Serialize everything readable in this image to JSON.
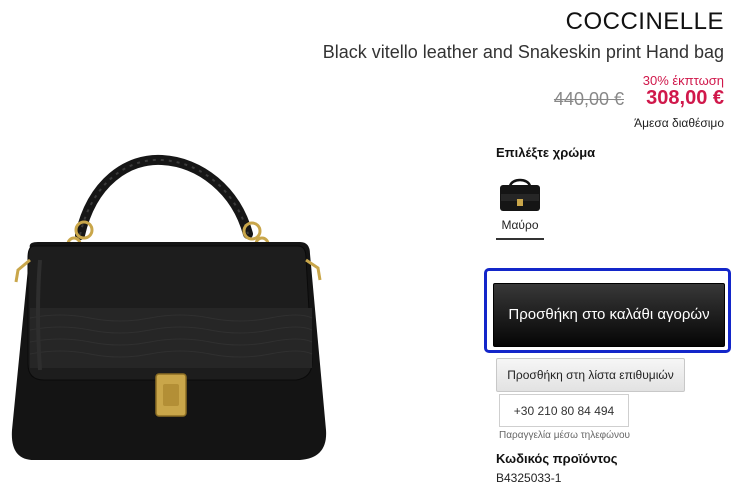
{
  "product": {
    "brand": "COCCINELLE",
    "name": "Black vitello leather and Snakeskin print Hand bag",
    "discount": "30% έκπτωση",
    "old_price": "440,00 €",
    "new_price": "308,00 €",
    "availability": "Άμεσα διαθέσιμο"
  },
  "colors": {
    "label": "Επιλέξτε χρώμα",
    "options": [
      {
        "name": "Μαύρο"
      }
    ]
  },
  "actions": {
    "add_to_cart": "Προσθήκη στο καλάθι αγορών",
    "add_to_wishlist": "Προσθήκη στη λίστα επιθυμιών",
    "phone": "+30 210 80 84 494",
    "phone_note": "Παραγγελία μέσω τηλεφώνου"
  },
  "product_code": {
    "label": "Κωδικός προϊόντος",
    "value": "B4325033-1"
  },
  "theme": {
    "sale_color": "#d0184b",
    "focus_color": "#1326c9",
    "button_dark": "#111111"
  }
}
